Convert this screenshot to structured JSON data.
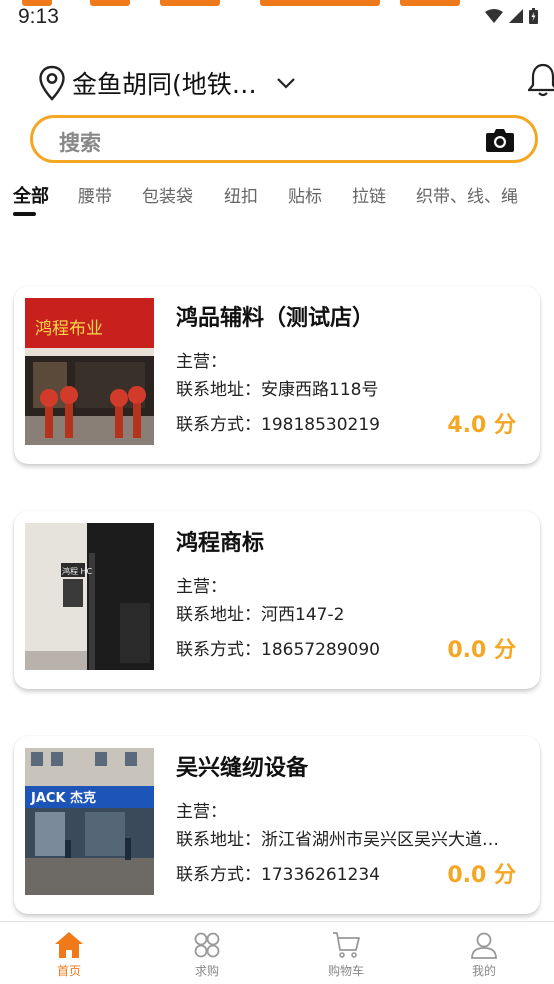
{
  "status_bar": {
    "time": "9:13"
  },
  "location": {
    "text": "金鱼胡同(地铁…"
  },
  "search": {
    "placeholder": "搜索"
  },
  "categories": [
    {
      "label": "全部",
      "active": true
    },
    {
      "label": "腰带",
      "active": false
    },
    {
      "label": "包装袋",
      "active": false
    },
    {
      "label": "纽扣",
      "active": false
    },
    {
      "label": "贴标",
      "active": false
    },
    {
      "label": "拉链",
      "active": false
    },
    {
      "label": "织带、线、绳",
      "active": false
    }
  ],
  "stores": [
    {
      "name": "鸿品辅料（测试店）",
      "main_label": "主营：",
      "main_value": "",
      "address_label": "联系地址：",
      "address_value": "安康西路118号",
      "phone_label": "联系方式：",
      "phone_value": "19818530219",
      "score": "4.0 分",
      "photo_signboard": "鸿程布业"
    },
    {
      "name": "鸿程商标",
      "main_label": "主营：",
      "main_value": "",
      "address_label": "联系地址：",
      "address_value": "河西147-2",
      "phone_label": "联系方式：",
      "phone_value": "18657289090",
      "score": "0.0 分",
      "photo_signboard": "鸿程 HC"
    },
    {
      "name": "吴兴缝纫设备",
      "main_label": "主营：",
      "main_value": "",
      "address_label": "联系地址：",
      "address_value": "浙江省湖州市吴兴区吴兴大道…",
      "phone_label": "联系方式：",
      "phone_value": "17336261234",
      "score": "0.0 分",
      "photo_signboard": "JACK 杰克"
    }
  ],
  "bottom_nav": [
    {
      "label": "首页",
      "icon": "home-icon",
      "active": true
    },
    {
      "label": "求购",
      "icon": "grid-icon",
      "active": false
    },
    {
      "label": "购物车",
      "icon": "cart-icon",
      "active": false
    },
    {
      "label": "我的",
      "icon": "user-icon",
      "active": false
    }
  ],
  "colors": {
    "accent": "#f5a623",
    "nav_active": "#f07a1a",
    "text_primary": "#111111",
    "text_secondary": "#666666"
  }
}
